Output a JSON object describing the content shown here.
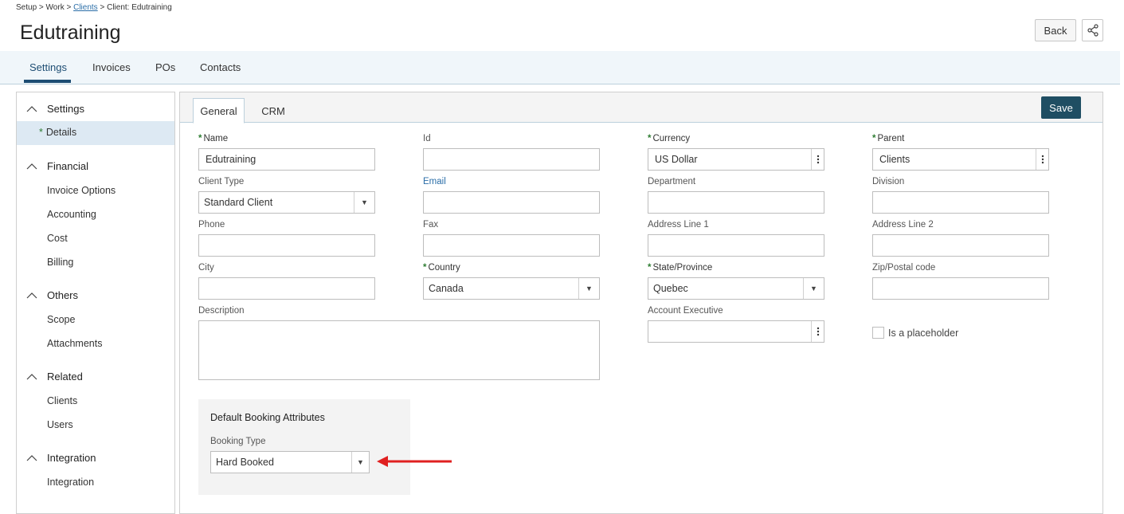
{
  "breadcrumb": {
    "setup": "Setup",
    "sep": ">",
    "work": "Work",
    "clients": "Clients",
    "current": "Client: Edutraining"
  },
  "page": {
    "title": "Edutraining"
  },
  "header": {
    "back_label": "Back",
    "share_icon": "share-icon"
  },
  "topnav": {
    "tabs": [
      {
        "label": "Settings",
        "active": true
      },
      {
        "label": "Invoices"
      },
      {
        "label": "POs"
      },
      {
        "label": "Contacts"
      }
    ]
  },
  "sidebar": {
    "sections": [
      {
        "title": "Settings",
        "items": [
          "Details"
        ]
      },
      {
        "title": "Financial",
        "items": [
          "Invoice Options",
          "Accounting",
          "Cost",
          "Billing"
        ]
      },
      {
        "title": "Others",
        "items": [
          "Scope",
          "Attachments"
        ]
      },
      {
        "title": "Related",
        "items": [
          "Clients",
          "Users"
        ]
      },
      {
        "title": "Integration",
        "items": [
          "Integration"
        ]
      }
    ],
    "active_item": "Details"
  },
  "content_tabs": {
    "tabs": [
      {
        "label": "General",
        "active": true
      },
      {
        "label": "CRM"
      }
    ],
    "save_label": "Save"
  },
  "form": {
    "name": {
      "label": "Name",
      "value": "Edutraining",
      "required": true
    },
    "id": {
      "label": "Id",
      "value": ""
    },
    "currency": {
      "label": "Currency",
      "value": "US Dollar",
      "required": true
    },
    "parent": {
      "label": "Parent",
      "value": "Clients",
      "required": true
    },
    "client_type": {
      "label": "Client Type",
      "value": "Standard Client"
    },
    "email": {
      "label": "Email",
      "value": ""
    },
    "department": {
      "label": "Department",
      "value": ""
    },
    "division": {
      "label": "Division",
      "value": ""
    },
    "phone": {
      "label": "Phone",
      "value": ""
    },
    "fax": {
      "label": "Fax",
      "value": ""
    },
    "address1": {
      "label": "Address Line 1",
      "value": ""
    },
    "address2": {
      "label": "Address Line 2",
      "value": ""
    },
    "city": {
      "label": "City",
      "value": ""
    },
    "country": {
      "label": "Country",
      "value": "Canada",
      "required": true
    },
    "state": {
      "label": "State/Province",
      "value": "Quebec",
      "required": true
    },
    "zip": {
      "label": "Zip/Postal code",
      "value": ""
    },
    "description": {
      "label": "Description",
      "value": ""
    },
    "account_exec": {
      "label": "Account Executive",
      "value": ""
    },
    "placeholder": {
      "label": "Is a placeholder",
      "checked": false
    }
  },
  "booking": {
    "title": "Default Booking Attributes",
    "type_label": "Booking Type",
    "type_value": "Hard Booked"
  },
  "annotation": {
    "arrow_color": "#e02020"
  },
  "colors": {
    "accent": "#1d4d73",
    "save_bg": "#1f4e63",
    "required": "#2e7d32",
    "link": "#2b6ea8"
  }
}
